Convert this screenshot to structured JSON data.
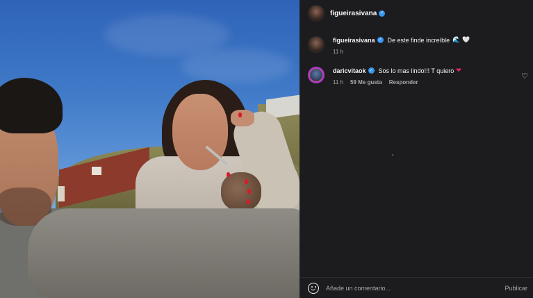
{
  "post": {
    "author": "figueirasivana",
    "author_verified": true
  },
  "caption": {
    "username": "figueirasivana",
    "text": "De este finde increíble",
    "emojis": [
      "🌊",
      "🤍"
    ],
    "time": "11 h"
  },
  "comments": [
    {
      "username": "daricvitaok",
      "text": "Sos lo mas lindo!!! T quiero",
      "emoji": "❤",
      "time": "11 h",
      "likes": "59 Me gusta",
      "reply_label": "Responder"
    }
  ],
  "composer": {
    "placeholder": "Añade un comentario...",
    "publish_label": "Publicar"
  },
  "icons": {
    "verified": "verified-badge-icon",
    "like": "heart-outline-icon",
    "emoji": "smiley-icon"
  },
  "colors": {
    "panel_bg": "#1c1c1e",
    "verified": "#3897f0",
    "heart_red": "#e0245e"
  }
}
